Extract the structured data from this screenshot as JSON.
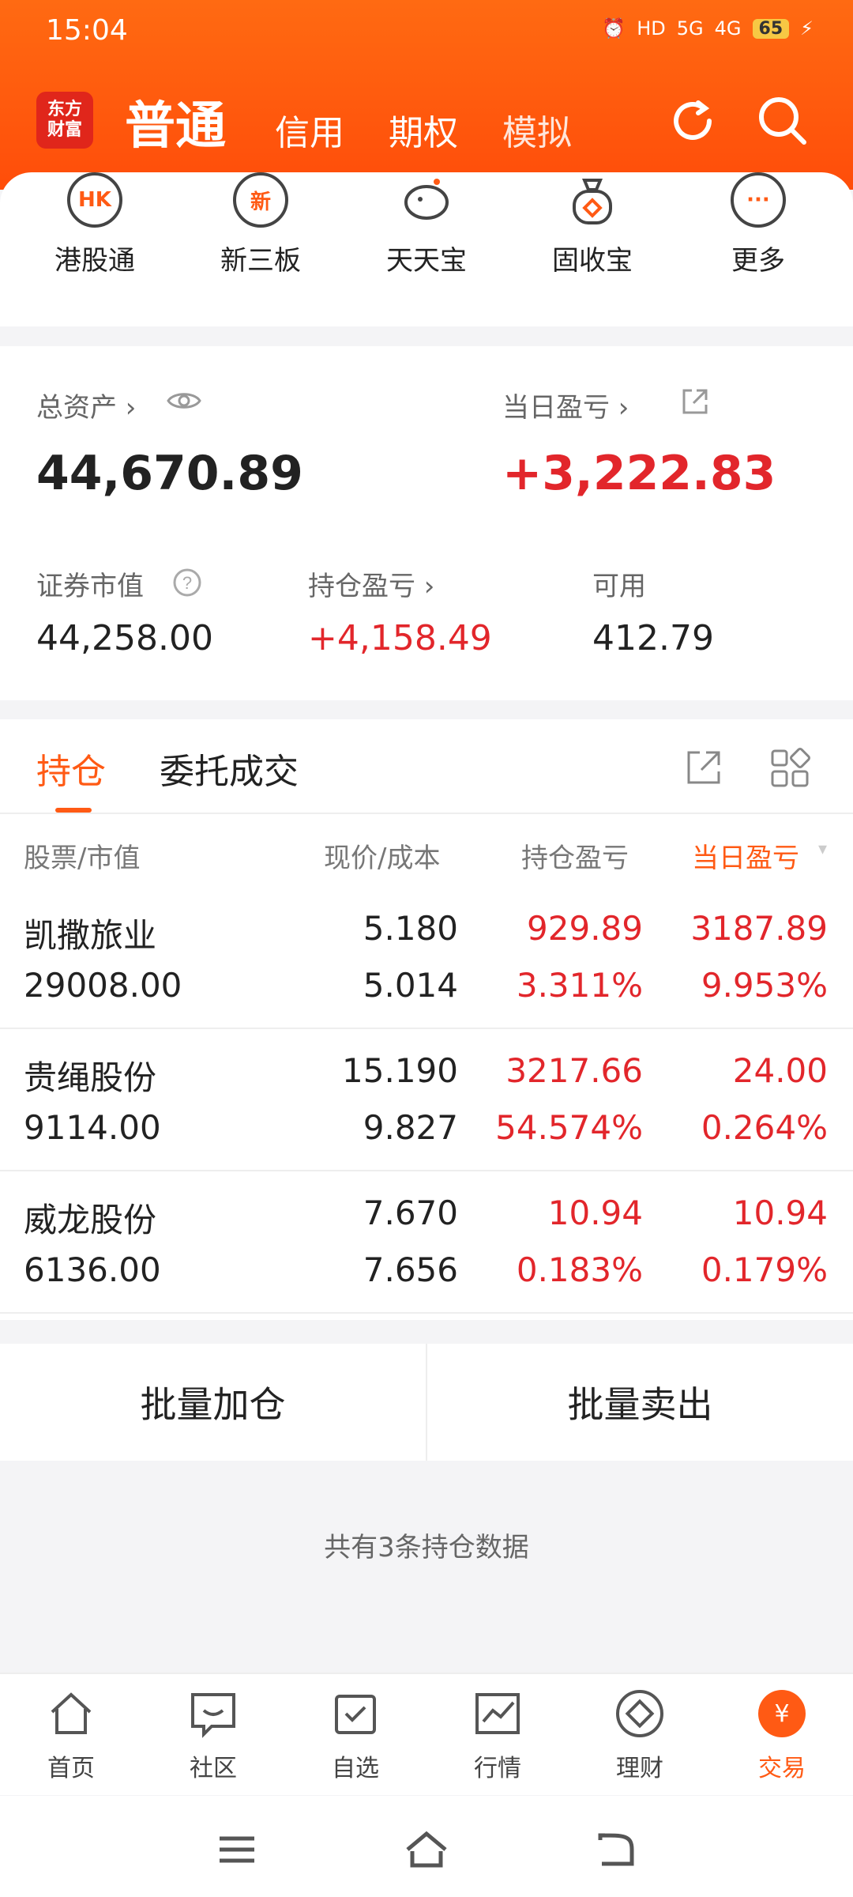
{
  "status": {
    "time": "15:04",
    "network": "5G",
    "network2": "4G",
    "hd": "HD",
    "battery": "65"
  },
  "header": {
    "logo": "东方\n财富",
    "tabs": [
      "普通",
      "信用",
      "期权",
      "模拟"
    ]
  },
  "features": [
    {
      "label": "港股通",
      "icon_text": "HK"
    },
    {
      "label": "新三板",
      "icon_text": "新"
    },
    {
      "label": "天天宝",
      "icon_text": ""
    },
    {
      "label": "固收宝",
      "icon_text": ""
    },
    {
      "label": "更多",
      "icon_text": "···"
    }
  ],
  "asset": {
    "total_label": "总资产",
    "total_value": "44,670.89",
    "daily_label": "当日盈亏",
    "daily_value": "+3,222.83",
    "market_label": "证券市值",
    "market_value": "44,258.00",
    "position_label": "持仓盈亏",
    "position_value": "+4,158.49",
    "available_label": "可用",
    "available_value": "412.79"
  },
  "holdings": {
    "tabs": [
      "持仓",
      "委托成交"
    ],
    "columns": [
      "股票/市值",
      "现价/成本",
      "持仓盈亏",
      "当日盈亏"
    ],
    "rows": [
      {
        "name": "凯撒旅业",
        "value": "29008.00",
        "price": "5.180",
        "cost": "5.014",
        "pnl": "929.89",
        "pnl_pct": "3.311%",
        "daily": "3187.89",
        "daily_pct": "9.953%"
      },
      {
        "name": "贵绳股份",
        "value": "9114.00",
        "price": "15.190",
        "cost": "9.827",
        "pnl": "3217.66",
        "pnl_pct": "54.574%",
        "daily": "24.00",
        "daily_pct": "0.264%"
      },
      {
        "name": "威龙股份",
        "value": "6136.00",
        "price": "7.670",
        "cost": "7.656",
        "pnl": "10.94",
        "pnl_pct": "0.183%",
        "daily": "10.94",
        "daily_pct": "0.179%"
      }
    ]
  },
  "actions": {
    "add": "批量加仓",
    "sell": "批量卖出"
  },
  "footer_text": "共有3条持仓数据",
  "bottom_nav": [
    {
      "label": "首页"
    },
    {
      "label": "社区"
    },
    {
      "label": "自选"
    },
    {
      "label": "行情"
    },
    {
      "label": "理财"
    },
    {
      "label": "交易",
      "icon_text": "¥"
    }
  ],
  "colors": {
    "accent": "#ff5a14",
    "red": "#e2262b"
  }
}
